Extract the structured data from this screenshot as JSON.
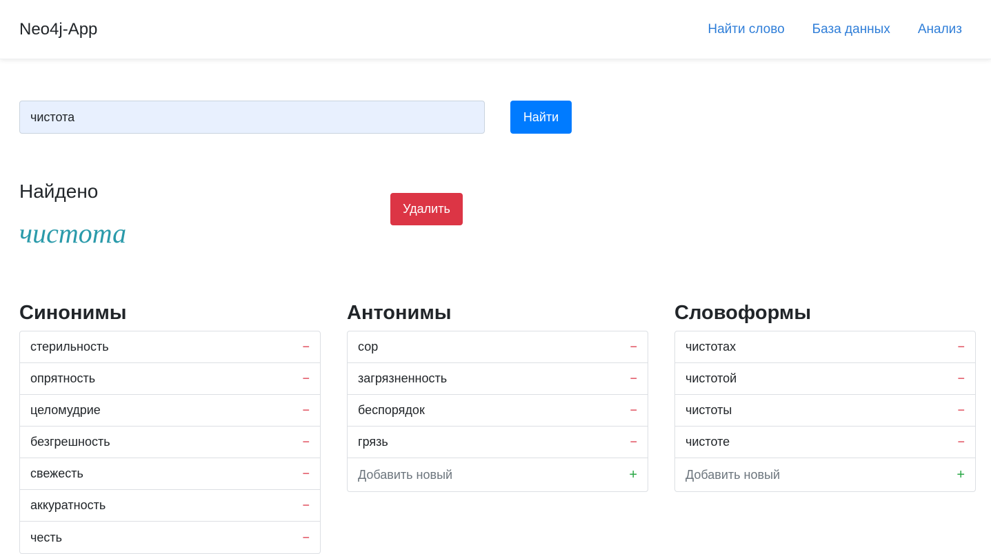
{
  "navbar": {
    "brand": "Neo4j-App",
    "links": [
      "Найти слово",
      "База данных",
      "Анализ"
    ]
  },
  "search": {
    "value": "чистота",
    "button_label": "Найти"
  },
  "result": {
    "found_label": "Найдено",
    "word": "чистота",
    "delete_label": "Удалить"
  },
  "columns": {
    "synonyms": {
      "title": "Синонимы",
      "items": [
        "стерильность",
        "опрятность",
        "целомудрие",
        "безгрешность",
        "свежесть",
        "аккуратность",
        "честь"
      ]
    },
    "antonyms": {
      "title": "Антонимы",
      "items": [
        "сор",
        "загрязненность",
        "беспорядок",
        "грязь"
      ],
      "add_placeholder": "Добавить новый"
    },
    "wordforms": {
      "title": "Словоформы",
      "items": [
        "чистотах",
        "чистотой",
        "чистоты",
        "чистоте"
      ],
      "add_placeholder": "Добавить новый"
    }
  },
  "icons": {
    "remove": "−",
    "add": "+"
  },
  "colors": {
    "primary": "#007bff",
    "danger": "#dc3545",
    "success": "#28a745",
    "word_accent": "#2a9aaa"
  }
}
